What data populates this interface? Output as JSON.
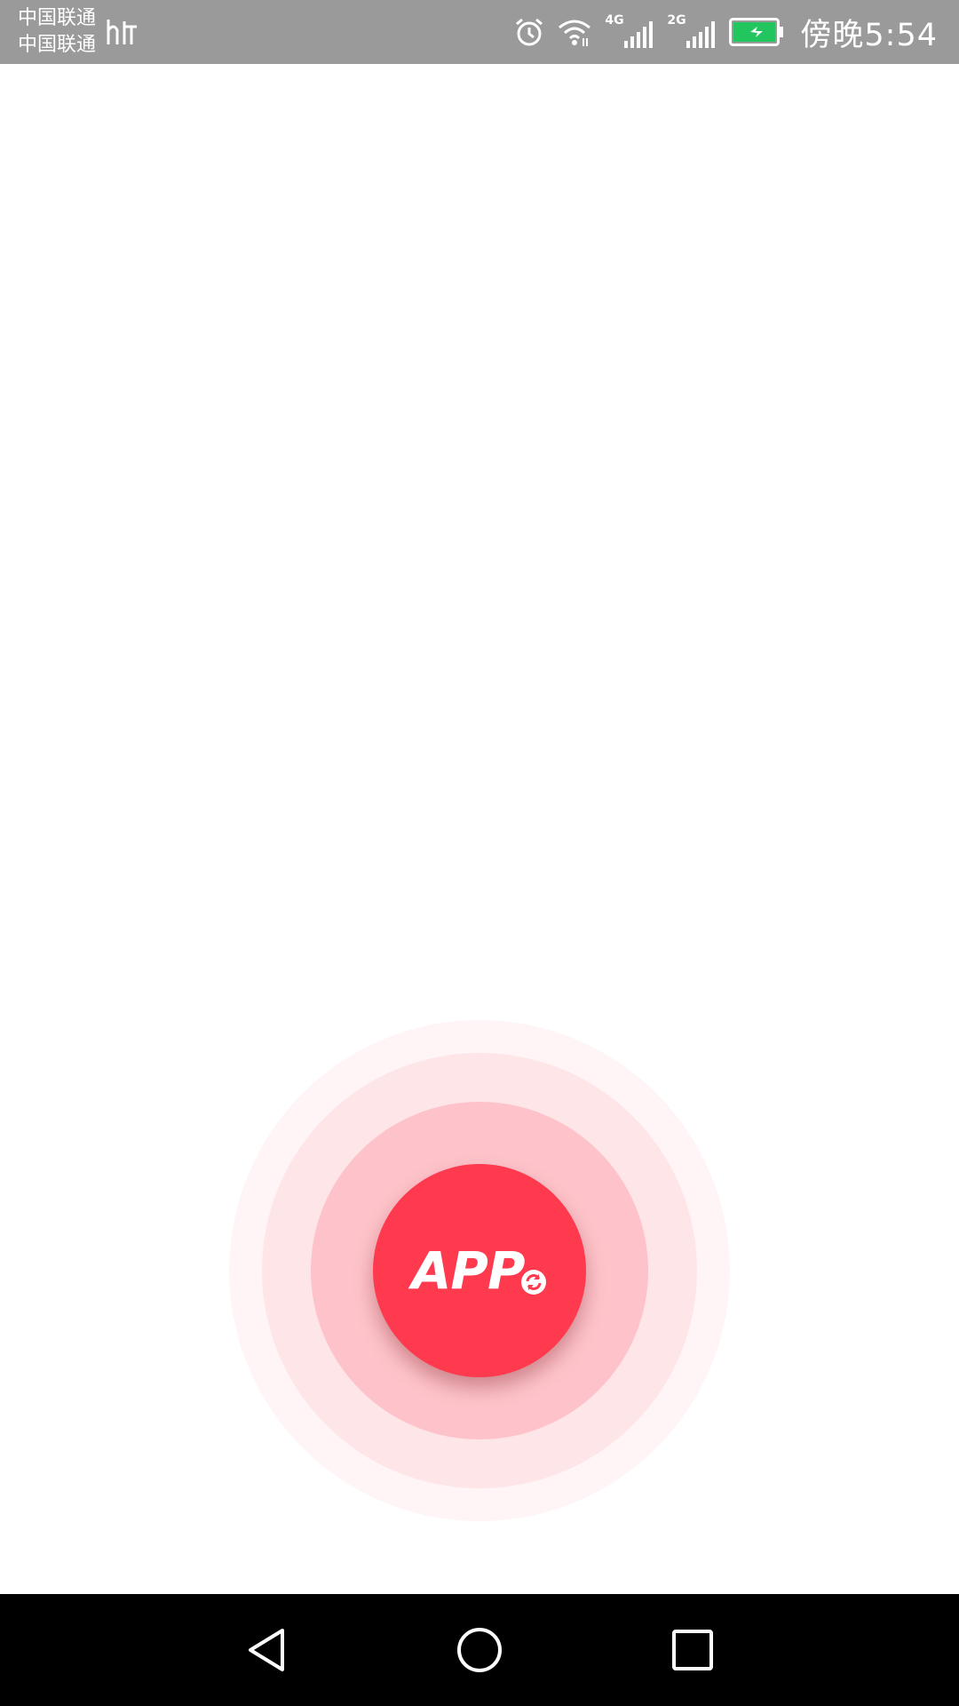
{
  "status_bar": {
    "carrier_1": "中国联通",
    "carrier_2": "中国联通",
    "hd_icon": "hd-voice-icon",
    "alarm_icon": "alarm-clock-icon",
    "wifi_icon": "wifi-icon",
    "signal_1_tag": "4G",
    "signal_2_tag": "2G",
    "battery_icon": "battery-charging-icon",
    "time": "傍晚5:54",
    "background_color": "#9a9a9a"
  },
  "main": {
    "app_button": {
      "logo_text": "APP",
      "logo_icon": "sync-icon",
      "color": "#ff3a4e"
    },
    "ripple_colors": [
      "#fec3ca",
      "#fee5e8",
      "#fff5f6"
    ]
  },
  "nav_bar": {
    "back_icon": "back-triangle-icon",
    "home_icon": "home-circle-icon",
    "recent_icon": "recent-apps-square-icon"
  }
}
